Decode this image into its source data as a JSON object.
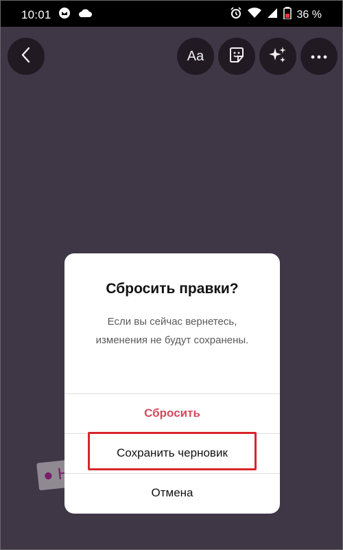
{
  "status_bar": {
    "time": "10:01",
    "battery_percent": "36 %",
    "icons": [
      "gmail-like-icon",
      "cloud-icon",
      "alarm-icon",
      "wifi-icon",
      "signal-icon",
      "battery-low-icon"
    ]
  },
  "toolbar": {
    "back_icon": "chevron-left-icon",
    "text_button_label": "Aa",
    "sticker_icon": "sticker-icon",
    "effects_icon": "sparkles-icon",
    "more_icon": "more-horizontal-icon"
  },
  "canvas": {
    "background_color": "#3f3646",
    "sticker_fragment": "● H"
  },
  "dialog": {
    "title": "Сбросить правки?",
    "message": "Если вы сейчас вернетесь, изменения не будут сохранены.",
    "actions": {
      "discard": "Сбросить",
      "save_draft": "Сохранить черновик",
      "cancel": "Отмена"
    },
    "colors": {
      "discard": "#d44a5b",
      "highlight": "#d9232b"
    }
  }
}
